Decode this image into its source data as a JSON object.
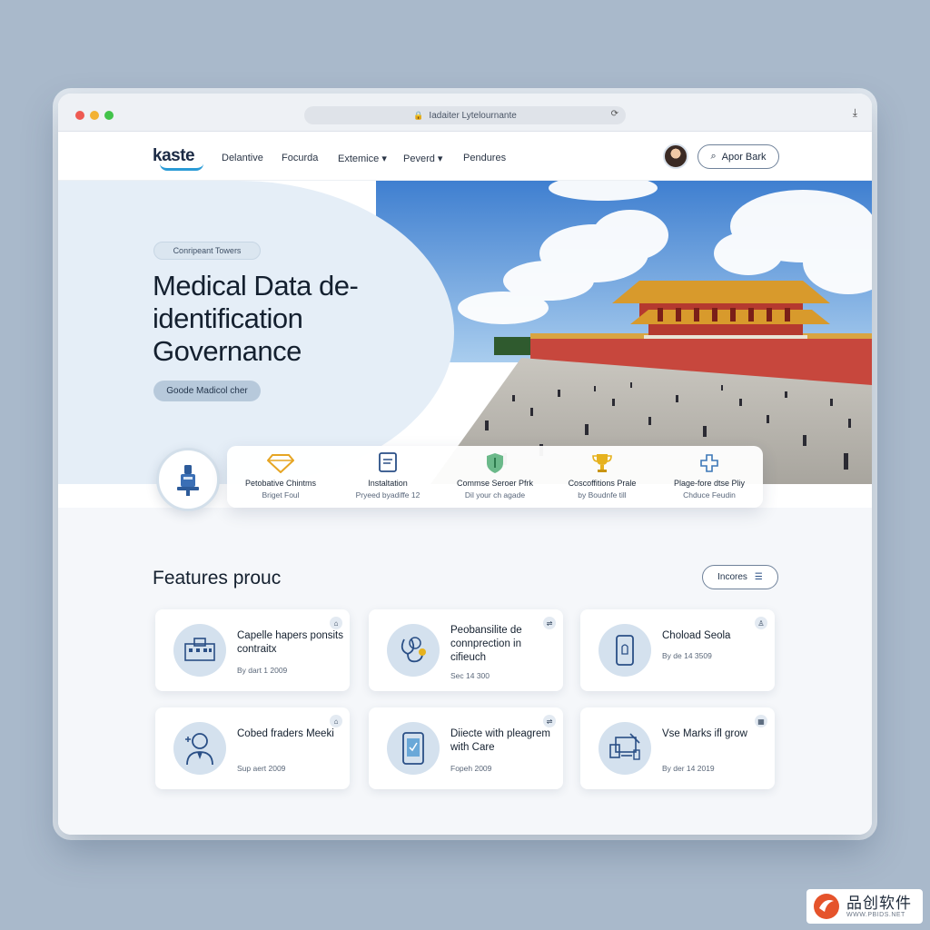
{
  "browser": {
    "url": "Iadaiter Lytelournante"
  },
  "nav": {
    "logo": "kaste",
    "links": [
      "Delantive",
      "Focurda",
      "Extemice",
      "Peverd",
      "Pendures"
    ],
    "action_button": "Apor Bark"
  },
  "hero": {
    "tag": "Conripeant Towers",
    "title": "Medical Data de-identification Governance",
    "button": "Goode Madicol cher"
  },
  "strip": [
    {
      "icon": "diamond-icon",
      "title": "Petobative Chintms",
      "sub": "Briget Foul"
    },
    {
      "icon": "document-icon",
      "title": "Instaltation",
      "sub": "Pryeed byadiffe 12"
    },
    {
      "icon": "shield-icon",
      "title": "Commse Seroer Pfrk",
      "sub": "Dil your ch agade"
    },
    {
      "icon": "trophy-icon",
      "title": "Coscoffitions Prale",
      "sub": "by Boudnfe till"
    },
    {
      "icon": "plus-icon",
      "title": "Plage-fore dtse Pliy",
      "sub": "Chduce Feudin"
    }
  ],
  "features": {
    "title": "Features prouc",
    "incomes_button": "Incores",
    "cards": [
      {
        "icon": "hospital-icon",
        "title": "Capelle hapers ponsits contraitx",
        "sub": "By dart 1 2009"
      },
      {
        "icon": "stethoscope-icon",
        "title": "Peobansilite de connprection in cifieuch",
        "sub": "Sec 14 300"
      },
      {
        "icon": "phone-icon",
        "title": "Choload Seola",
        "sub": "By de 14 3509"
      },
      {
        "icon": "doctor-icon",
        "title": "Cobed fraders Meeki",
        "sub": "Sup aert 2009"
      },
      {
        "icon": "tablet-icon",
        "title": "Diiecte with pleagrem with Care",
        "sub": "Fopeh 2009"
      },
      {
        "icon": "devices-icon",
        "title": "Vse Marks ifl grow",
        "sub": "By der 14 2019"
      }
    ]
  },
  "watermark": {
    "cn": "品创软件",
    "url": "WWW.PBIDS.NET"
  },
  "colors": {
    "page_bg": "#a9b9cb",
    "accent": "#2a9bd6",
    "hero_bg": "#e5eef7"
  }
}
